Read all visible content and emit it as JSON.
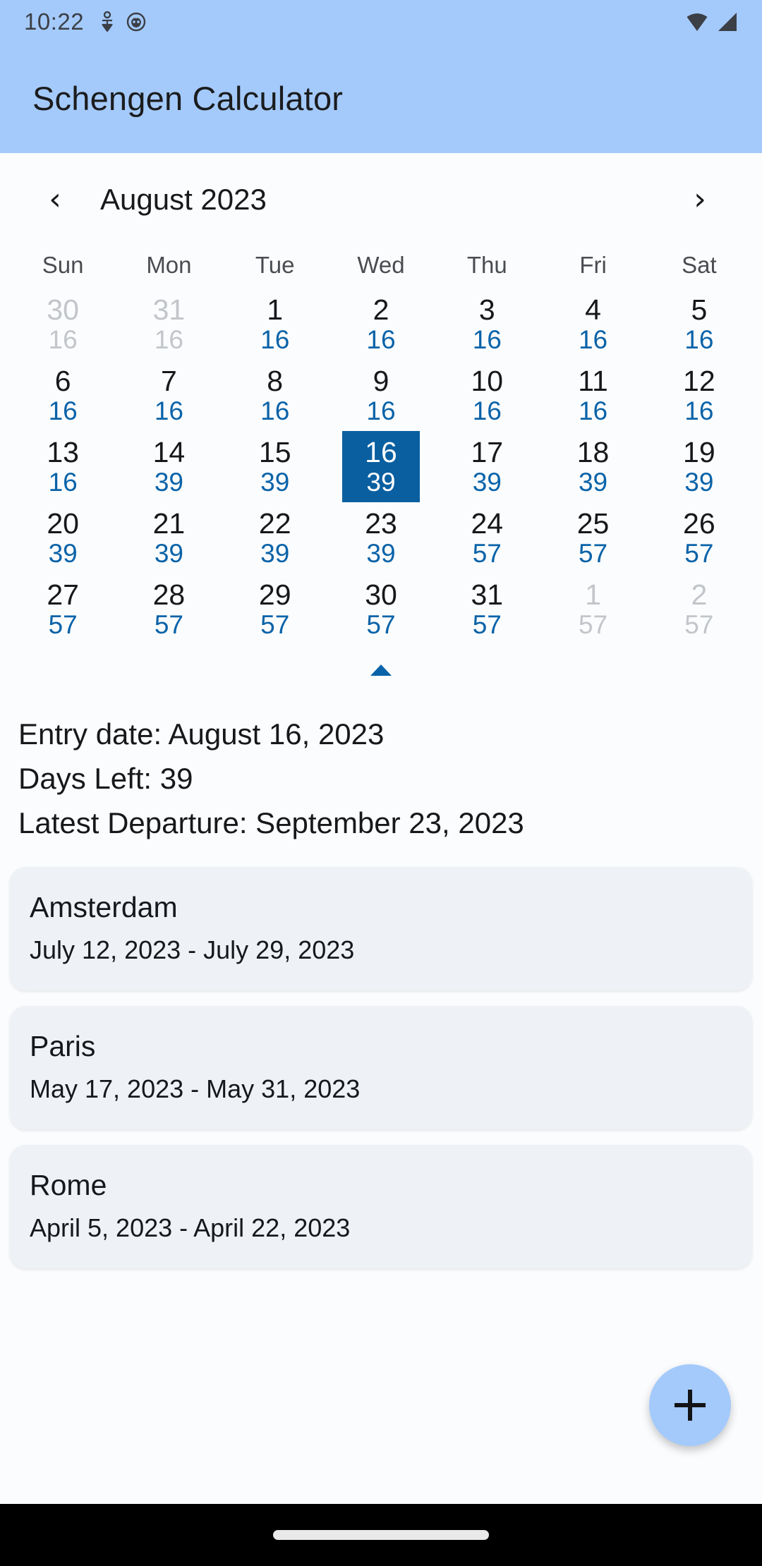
{
  "status_bar": {
    "time": "10:22",
    "left_icons": [
      "body-sensor-icon",
      "app-badge-icon"
    ],
    "right_icons": [
      "wifi-icon",
      "signal-icon"
    ]
  },
  "app_bar": {
    "title": "Schengen Calculator",
    "background_color": "#A4CAFB"
  },
  "calendar": {
    "prev_label": "‹",
    "next_label": "›",
    "month_label": "August 2023",
    "weekday_headers": [
      "Sun",
      "Mon",
      "Tue",
      "Wed",
      "Thu",
      "Fri",
      "Sat"
    ],
    "selected_color": "#0A5FA0",
    "days_left_color": "#0A63A8",
    "collapse_label": "collapse-calendar",
    "weeks": [
      [
        {
          "day": "30",
          "days_left": "16",
          "muted": true,
          "selected": false
        },
        {
          "day": "31",
          "days_left": "16",
          "muted": true,
          "selected": false
        },
        {
          "day": "1",
          "days_left": "16",
          "muted": false,
          "selected": false
        },
        {
          "day": "2",
          "days_left": "16",
          "muted": false,
          "selected": false
        },
        {
          "day": "3",
          "days_left": "16",
          "muted": false,
          "selected": false
        },
        {
          "day": "4",
          "days_left": "16",
          "muted": false,
          "selected": false
        },
        {
          "day": "5",
          "days_left": "16",
          "muted": false,
          "selected": false
        }
      ],
      [
        {
          "day": "6",
          "days_left": "16",
          "muted": false,
          "selected": false
        },
        {
          "day": "7",
          "days_left": "16",
          "muted": false,
          "selected": false
        },
        {
          "day": "8",
          "days_left": "16",
          "muted": false,
          "selected": false
        },
        {
          "day": "9",
          "days_left": "16",
          "muted": false,
          "selected": false
        },
        {
          "day": "10",
          "days_left": "16",
          "muted": false,
          "selected": false
        },
        {
          "day": "11",
          "days_left": "16",
          "muted": false,
          "selected": false
        },
        {
          "day": "12",
          "days_left": "16",
          "muted": false,
          "selected": false
        }
      ],
      [
        {
          "day": "13",
          "days_left": "16",
          "muted": false,
          "selected": false
        },
        {
          "day": "14",
          "days_left": "39",
          "muted": false,
          "selected": false
        },
        {
          "day": "15",
          "days_left": "39",
          "muted": false,
          "selected": false
        },
        {
          "day": "16",
          "days_left": "39",
          "muted": false,
          "selected": true
        },
        {
          "day": "17",
          "days_left": "39",
          "muted": false,
          "selected": false
        },
        {
          "day": "18",
          "days_left": "39",
          "muted": false,
          "selected": false
        },
        {
          "day": "19",
          "days_left": "39",
          "muted": false,
          "selected": false
        }
      ],
      [
        {
          "day": "20",
          "days_left": "39",
          "muted": false,
          "selected": false
        },
        {
          "day": "21",
          "days_left": "39",
          "muted": false,
          "selected": false
        },
        {
          "day": "22",
          "days_left": "39",
          "muted": false,
          "selected": false
        },
        {
          "day": "23",
          "days_left": "39",
          "muted": false,
          "selected": false
        },
        {
          "day": "24",
          "days_left": "57",
          "muted": false,
          "selected": false
        },
        {
          "day": "25",
          "days_left": "57",
          "muted": false,
          "selected": false
        },
        {
          "day": "26",
          "days_left": "57",
          "muted": false,
          "selected": false
        }
      ],
      [
        {
          "day": "27",
          "days_left": "57",
          "muted": false,
          "selected": false
        },
        {
          "day": "28",
          "days_left": "57",
          "muted": false,
          "selected": false
        },
        {
          "day": "29",
          "days_left": "57",
          "muted": false,
          "selected": false
        },
        {
          "day": "30",
          "days_left": "57",
          "muted": false,
          "selected": false
        },
        {
          "day": "31",
          "days_left": "57",
          "muted": false,
          "selected": false
        },
        {
          "day": "1",
          "days_left": "57",
          "muted": true,
          "selected": false
        },
        {
          "day": "2",
          "days_left": "57",
          "muted": true,
          "selected": false
        }
      ]
    ]
  },
  "summary": {
    "entry_date": "Entry date: August 16, 2023",
    "days_left": "Days Left: 39",
    "latest_departure": "Latest Departure: September 23, 2023"
  },
  "trips": [
    {
      "name": "Amsterdam",
      "dates": "July 12, 2023 - July 29, 2023"
    },
    {
      "name": "Paris",
      "dates": "May 17, 2023 - May 31, 2023"
    },
    {
      "name": "Rome",
      "dates": "April 5, 2023 - April 22, 2023"
    }
  ],
  "fab": {
    "icon": "plus-icon",
    "color": "#A4CAFB"
  }
}
